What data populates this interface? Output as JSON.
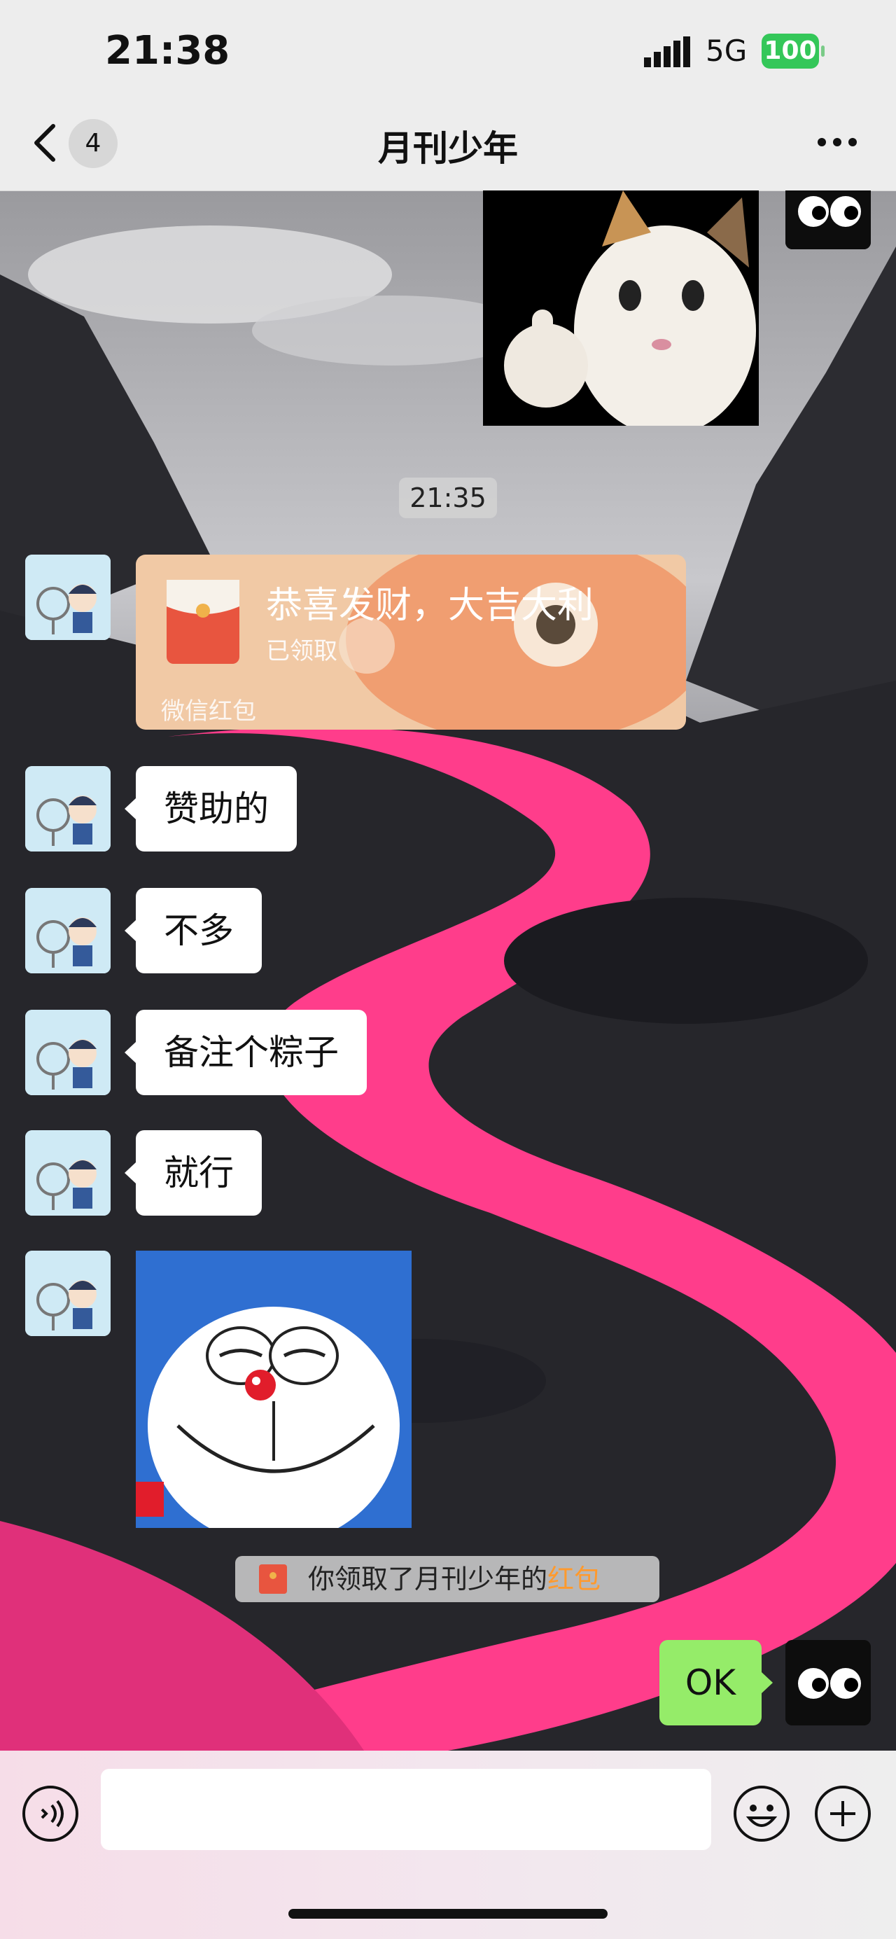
{
  "status_bar": {
    "time": "21:38",
    "network": "5G",
    "battery": "100"
  },
  "nav": {
    "unread_count": "4",
    "title": "月刊少年"
  },
  "chat": {
    "timestamp": "21:35",
    "red_packet": {
      "greeting": "恭喜发财，大吉大利",
      "status": "已领取",
      "label": "微信红包"
    },
    "messages": [
      "赞助的",
      "不多",
      "备注个粽子",
      "就行"
    ],
    "system_notice": {
      "prefix": "你领取了月刊少年的",
      "link": "红包"
    },
    "my_reply": "OK"
  },
  "input": {
    "value": "",
    "placeholder": ""
  },
  "colors": {
    "nav_bg": "#ededed",
    "my_bubble": "#95ec69",
    "red_packet_bg": "#f1c9a5",
    "accent_link": "#ff9a2e",
    "river_pink": "#ff3d8b"
  },
  "icons": [
    "back-chevron-icon",
    "more-dots-icon",
    "voice-icon",
    "emoji-icon",
    "plus-icon",
    "red-packet-icon",
    "signal-icon"
  ]
}
